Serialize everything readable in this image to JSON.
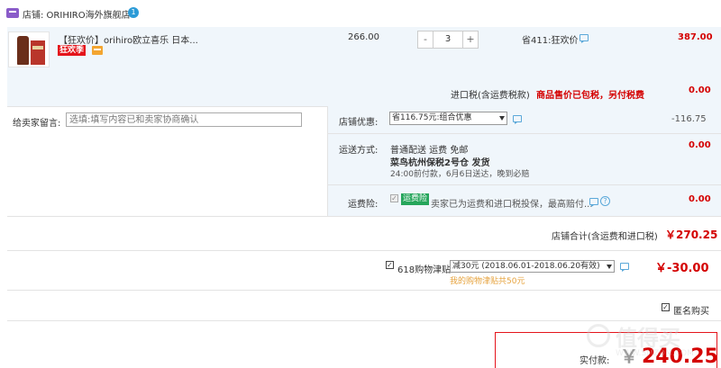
{
  "shop": {
    "label": "店铺: ORIHIRO海外旗舰店",
    "badge": "1"
  },
  "item": {
    "title": "【狂欢价】orihiro欧立喜乐 日本...",
    "tag_festival": "狂欢季",
    "unit_price": "266.00",
    "quantity": "3",
    "minus": "-",
    "plus": "+",
    "promo": "省411:狂欢价",
    "total": "387.00"
  },
  "tax": {
    "label": "进口税(含运费税款)",
    "note": "商品售价已包税，另付税费",
    "value": "0.00"
  },
  "message": {
    "label": "给卖家留言:",
    "placeholder": "选填:填写内容已和卖家协商确认"
  },
  "discount": {
    "label": "店铺优惠:",
    "selected": "省116.75元:组合优惠",
    "value": "-116.75"
  },
  "shipping": {
    "label": "运送方式:",
    "line1": "普通配送 运费 免邮",
    "line2": "菜鸟杭州保税2号仓  发货",
    "line3": "24:00前付款，6月6日送达，晚到必赔",
    "value": "0.00"
  },
  "insurance": {
    "label": "运费险:",
    "check": "✓",
    "tag": "运费险",
    "desc": "卖家已为运费和进口税投保，最高赔付...",
    "help": "?",
    "value": "0.00"
  },
  "shop_total": {
    "label": "店铺合计(含运费和进口税)",
    "value": "￥270.25"
  },
  "bonus": {
    "check": "✓",
    "label": "618购物津贴",
    "selected": "减30元 (2018.06.01-2018.06.20有效)",
    "note": "我的购物津贴共50元",
    "value": "￥-30.00"
  },
  "anonymous": {
    "check": "✓",
    "label": "匿名购买"
  },
  "payment": {
    "label": "实付款:",
    "currency": "￥",
    "amount": "240.25"
  },
  "watermark": {
    "text": "值得买",
    "sub": "WWW.SMZDM.COM"
  },
  "colors": {
    "accent_red": "#d40000",
    "panel_blue": "#f0f6fb",
    "link_blue": "#5aa8d9",
    "insurance_green": "#26a65b"
  },
  "icons": [
    "shop-icon",
    "chat-icon",
    "help-icon",
    "dropdown-arrow-icon"
  ]
}
